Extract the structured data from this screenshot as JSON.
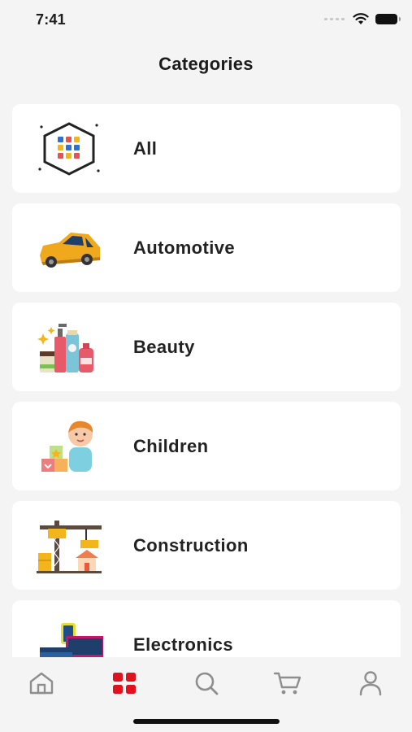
{
  "status_bar": {
    "time": "7:41"
  },
  "header": {
    "title": "Categories"
  },
  "categories": [
    {
      "label": "All",
      "icon": "grid-hexagon-icon"
    },
    {
      "label": "Automotive",
      "icon": "car-icon"
    },
    {
      "label": "Beauty",
      "icon": "cosmetics-icon"
    },
    {
      "label": "Children",
      "icon": "child-blocks-icon"
    },
    {
      "label": "Construction",
      "icon": "crane-icon"
    },
    {
      "label": "Electronics",
      "icon": "devices-icon"
    }
  ],
  "tab_bar": {
    "tabs": [
      {
        "icon": "home-icon",
        "active": false
      },
      {
        "icon": "categories-icon",
        "active": true
      },
      {
        "icon": "search-icon",
        "active": false
      },
      {
        "icon": "cart-icon",
        "active": false
      },
      {
        "icon": "profile-icon",
        "active": false
      }
    ],
    "active_color": "#e0121e",
    "inactive_color": "#8e8e8e"
  }
}
